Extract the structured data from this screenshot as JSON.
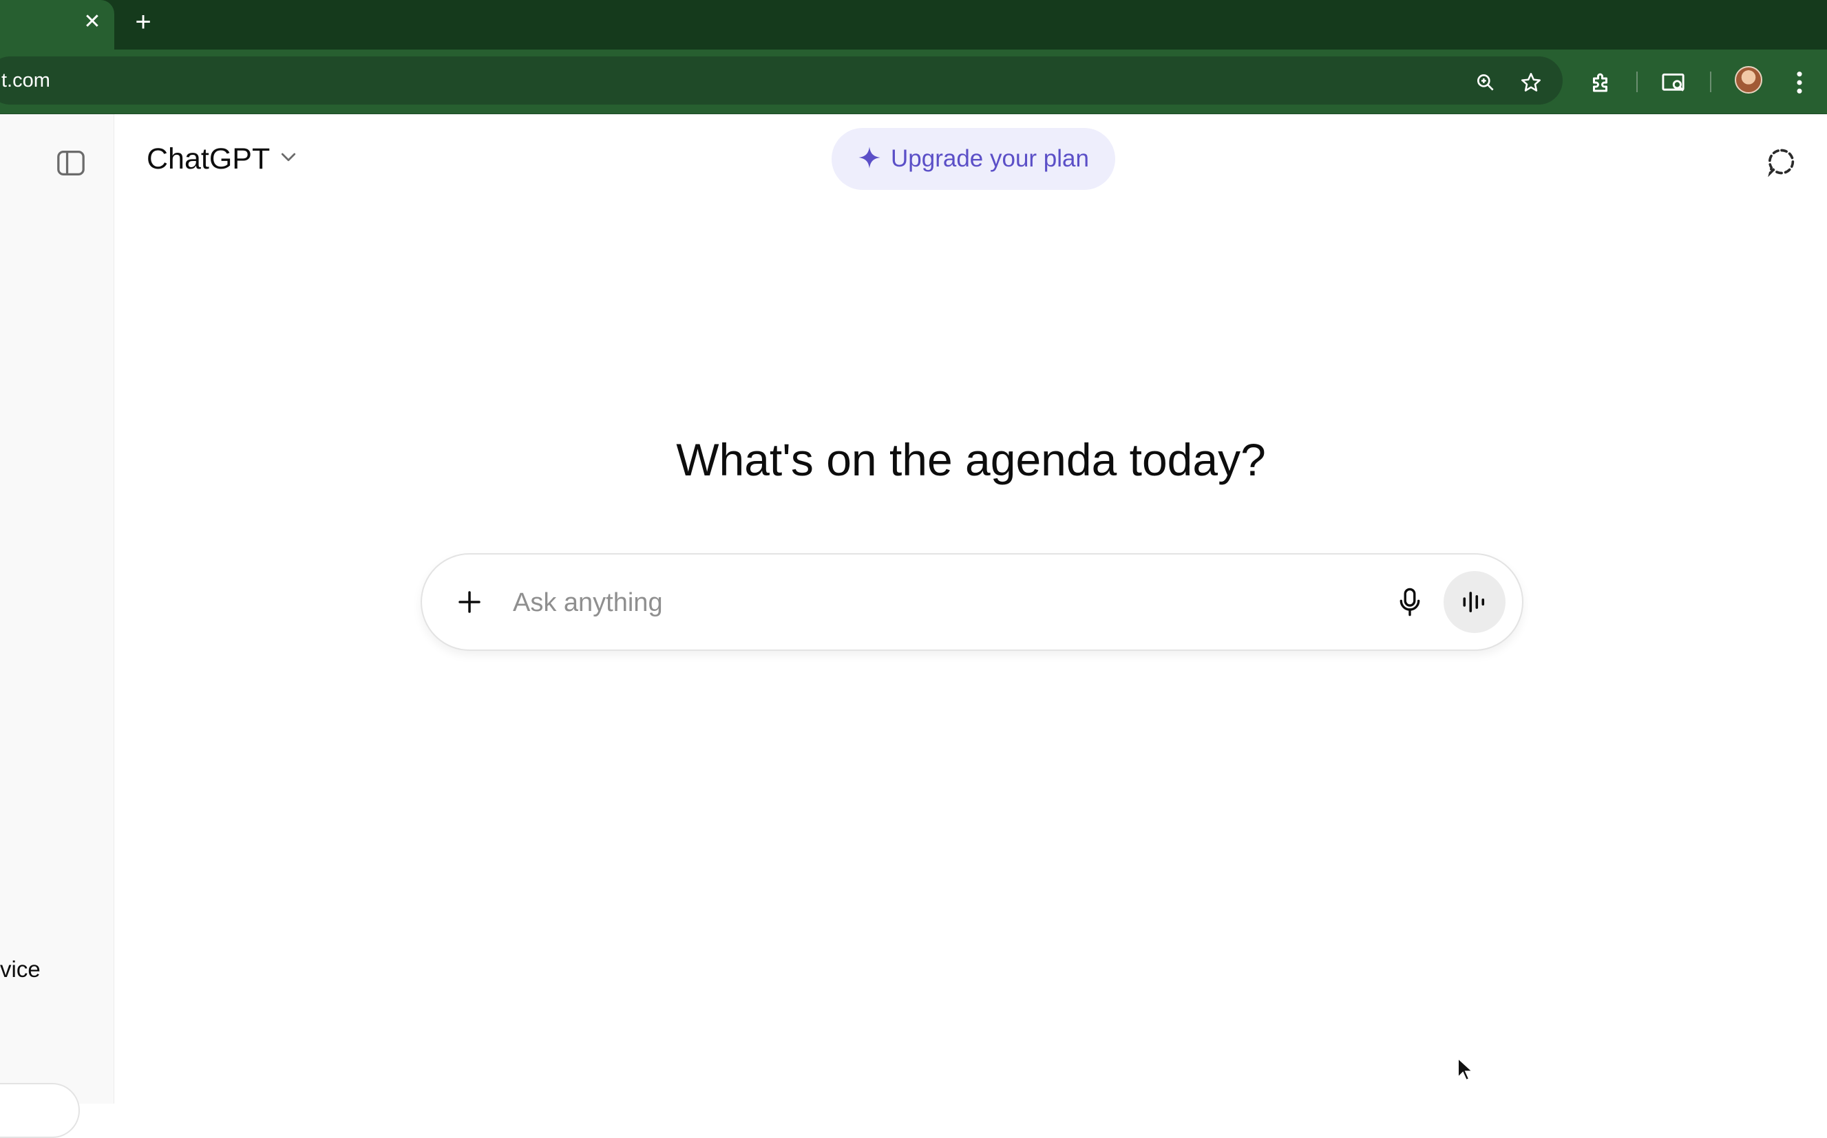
{
  "browser": {
    "tab_close_glyph": "✕",
    "new_tab_glyph": "+",
    "url_fragment": "t.com",
    "toolbar_icons": [
      "zoom-icon",
      "bookmark-star-icon",
      "extensions-icon",
      "reading-list-icon",
      "profile-avatar",
      "more-menu-icon"
    ]
  },
  "sidebar": {
    "toggle_icon": "sidebar-toggle-icon",
    "partial_item_label": "vice"
  },
  "header": {
    "model_name": "ChatGPT",
    "upgrade_label": "Upgrade your plan",
    "temporary_chat_icon": "temporary-chat-icon"
  },
  "main": {
    "greeting": "What's on the agenda today?"
  },
  "composer": {
    "placeholder": "Ask anything",
    "value": ""
  },
  "colors": {
    "tabbar_bg": "#153a1c",
    "toolbar_bg": "#275f30",
    "omnibox_bg": "#1f4a28",
    "upgrade_bg": "#eeeefc",
    "upgrade_accent": "#5b4fc7",
    "sidebar_bg": "#f9f9f9"
  }
}
